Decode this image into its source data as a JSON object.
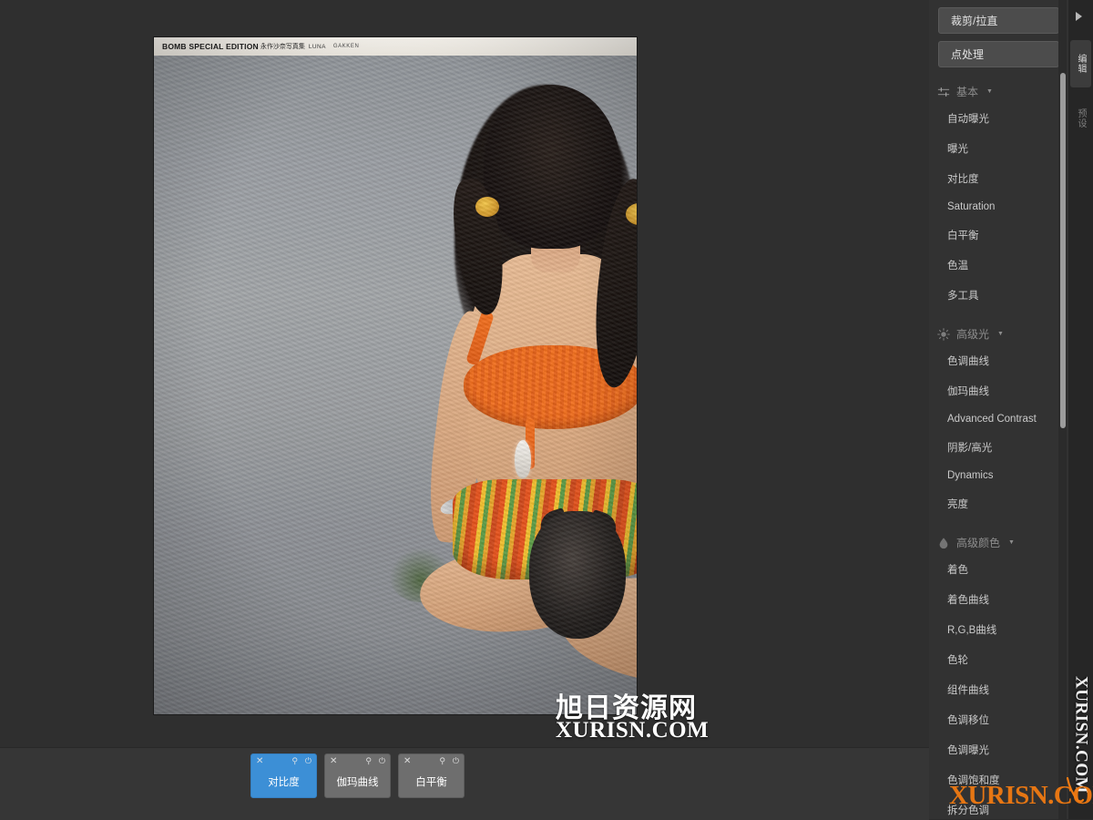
{
  "app": {
    "name": "photo-editor"
  },
  "canvas": {
    "poster": {
      "banner_title": "BOMB SPECIAL EDITION",
      "banner_sub": "永作沙奈写真集",
      "banner_sub2": "LUNA",
      "banner_brand": "GAKKEN"
    }
  },
  "watermarks": {
    "center_cn": "旭日资源网",
    "center_en": "XURISN.COM",
    "vertical": "XURISN.COM",
    "orange": "XURISN.COM"
  },
  "bottom_bar": {
    "chips": [
      {
        "label": "对比度",
        "active": true,
        "close_icon": "close-icon",
        "pin_icon": "pin-icon",
        "power_icon": "power-icon"
      },
      {
        "label": "伽玛曲线",
        "active": false,
        "close_icon": "close-icon",
        "pin_icon": "pin-icon",
        "power_icon": "power-icon"
      },
      {
        "label": "白平衡",
        "active": false,
        "close_icon": "close-icon",
        "pin_icon": "pin-icon",
        "power_icon": "power-icon"
      }
    ]
  },
  "sidebar": {
    "buttons": [
      {
        "label": "裁剪/拉直"
      },
      {
        "label": "点处理"
      }
    ],
    "groups": [
      {
        "title": "基本",
        "icon": "sliders-icon",
        "caret": "▼",
        "items": [
          {
            "label": "自动曝光"
          },
          {
            "label": "曝光"
          },
          {
            "label": "对比度"
          },
          {
            "label": "Saturation"
          },
          {
            "label": "白平衡"
          },
          {
            "label": "色温"
          },
          {
            "label": "多工具"
          }
        ]
      },
      {
        "title": "高级光",
        "icon": "sun-icon",
        "caret": "▼",
        "items": [
          {
            "label": "色调曲线"
          },
          {
            "label": "伽玛曲线"
          },
          {
            "label": "Advanced Contrast"
          },
          {
            "label": "阴影/高光"
          },
          {
            "label": "Dynamics"
          },
          {
            "label": "亮度"
          }
        ]
      },
      {
        "title": "高级颜色",
        "icon": "droplet-icon",
        "caret": "▼",
        "items": [
          {
            "label": "着色"
          },
          {
            "label": "着色曲线"
          },
          {
            "label": "R,G,B曲线"
          },
          {
            "label": "色轮"
          },
          {
            "label": "组件曲线"
          },
          {
            "label": "色调移位"
          },
          {
            "label": "色调曝光"
          },
          {
            "label": "色调饱和度"
          },
          {
            "label": "拆分色调"
          }
        ]
      }
    ],
    "scrollbar": {
      "name": "sidebar-scrollbar"
    }
  },
  "rail": {
    "collapse_arrow": "▶",
    "tabs": [
      {
        "label": "编辑",
        "active": true
      },
      {
        "label": "预设",
        "active": false
      }
    ]
  },
  "colors": {
    "accent": "#3c8fd6",
    "panel_bg": "#323232",
    "canvas_bg": "#2f2f2f",
    "watermark_orange": "#f07a12"
  }
}
